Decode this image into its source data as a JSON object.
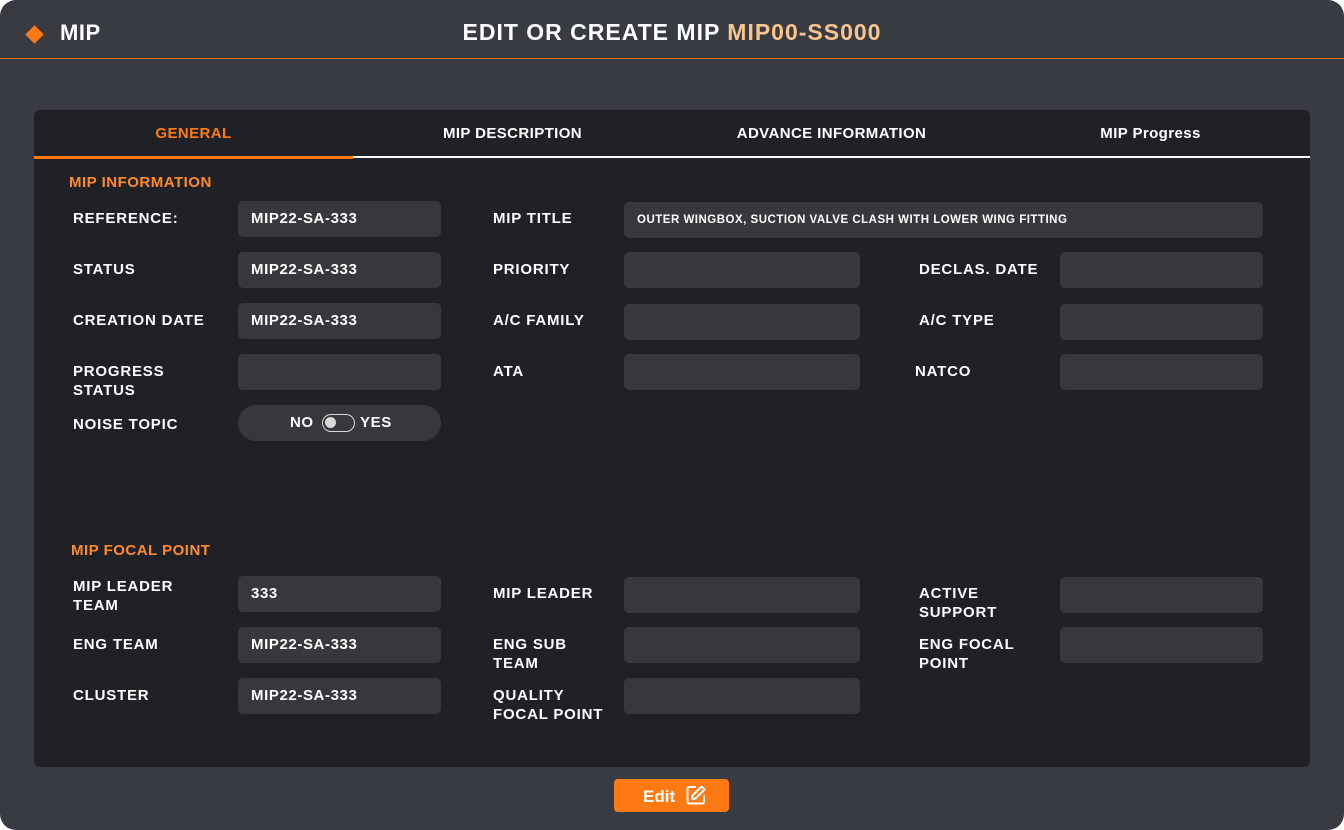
{
  "header": {
    "app_name": "MIP",
    "title_prefix": "EDIT OR CREATE MIP",
    "title_code": "MIP00-SS000"
  },
  "tabs": [
    {
      "label": "GENERAL",
      "active": true
    },
    {
      "label": "MIP DESCRIPTION",
      "active": false
    },
    {
      "label": "ADVANCE INFORMATION",
      "active": false
    },
    {
      "label": "MIP Progress",
      "active": false
    }
  ],
  "mip_information": {
    "title": "MIP INFORMATION",
    "reference": {
      "label": "REFERENCE:",
      "value": "MIP22-SA-333"
    },
    "status": {
      "label": "STATUS",
      "value": "MIP22-SA-333"
    },
    "creation_date": {
      "label": "CREATION DATE",
      "value": "MIP22-SA-333"
    },
    "progress_status": {
      "label_line1": "PROGRESS",
      "label_line2": "STATUS",
      "value": ""
    },
    "noise_topic": {
      "label": "NOISE TOPIC",
      "no": "NO",
      "yes": "YES",
      "value": "NO"
    },
    "mip_title": {
      "label": "MIP TITLE",
      "value": "OUTER WINGBOX, SUCTION VALVE CLASH WITH LOWER WING FITTING"
    },
    "priority": {
      "label": "PRIORITY",
      "value": ""
    },
    "ac_family": {
      "label": "A/C FAMILY",
      "value": ""
    },
    "ata": {
      "label": "ATA",
      "value": ""
    },
    "declas_date": {
      "label": "DECLAS. DATE",
      "value": ""
    },
    "ac_type": {
      "label": "A/C TYPE",
      "value": ""
    },
    "natco": {
      "label": "NATCO",
      "value": ""
    }
  },
  "mip_focal_point": {
    "title": "MIP FOCAL POINT",
    "leader_team": {
      "label_line1": "MIP LEADER",
      "label_line2": "TEAM",
      "value": "333"
    },
    "eng_team": {
      "label": "ENG TEAM",
      "value": "MIP22-SA-333"
    },
    "cluster": {
      "label": "CLUSTER",
      "value": "MIP22-SA-333"
    },
    "mip_leader": {
      "label": "MIP LEADER",
      "value": ""
    },
    "eng_sub_team": {
      "label_line1": "ENG SUB",
      "label_line2": "TEAM",
      "value": ""
    },
    "quality_focal_point": {
      "label_line1": "QUALITY",
      "label_line2": "FOCAL POINT",
      "value": ""
    },
    "active_support": {
      "label_line1": "ACTIVE",
      "label_line2": "SUPPORT",
      "value": ""
    },
    "eng_focal_point": {
      "label_line1": "ENG FOCAL",
      "label_line2": "POINT",
      "value": ""
    }
  },
  "footer": {
    "edit_label": "Edit"
  },
  "colors": {
    "accent": "#ff7a12",
    "code": "#f8c58f",
    "background": "#393b42",
    "panel": "#1f2127",
    "field": "#37383b"
  },
  "icons": {
    "brand": "diamond-icon",
    "edit": "edit-square-icon"
  }
}
